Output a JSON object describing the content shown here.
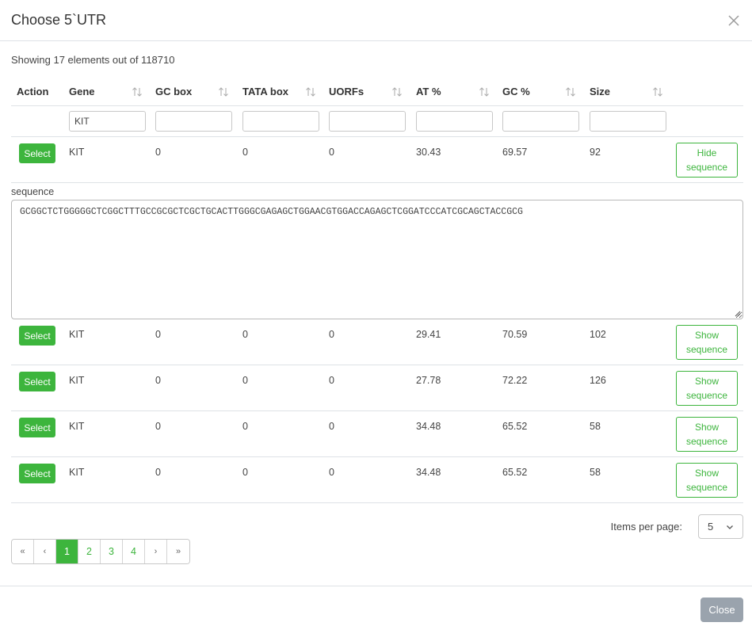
{
  "modal": {
    "title": "Choose 5`UTR",
    "close_label": "Close"
  },
  "summary": "Showing 17 elements out of 118710",
  "columns": [
    {
      "key": "action",
      "label": "Action"
    },
    {
      "key": "gene",
      "label": "Gene"
    },
    {
      "key": "gc_box",
      "label": "GC box"
    },
    {
      "key": "tata_box",
      "label": "TATA box"
    },
    {
      "key": "uorfs",
      "label": "UORFs"
    },
    {
      "key": "at",
      "label": "AT %"
    },
    {
      "key": "gc",
      "label": "GC %"
    },
    {
      "key": "size",
      "label": "Size"
    }
  ],
  "filters": {
    "gene": "KIT",
    "gc_box": "",
    "tata_box": "",
    "uorfs": "",
    "at": "",
    "gc": "",
    "size": ""
  },
  "select_label": "Select",
  "rows": [
    {
      "gene": "KIT",
      "gc_box": "0",
      "tata_box": "0",
      "uorfs": "0",
      "at": "30.43",
      "gc": "69.57",
      "size": "92",
      "toggle_label": "Hide sequence"
    },
    {
      "gene": "KIT",
      "gc_box": "0",
      "tata_box": "0",
      "uorfs": "0",
      "at": "29.41",
      "gc": "70.59",
      "size": "102",
      "toggle_label": "Show sequence"
    },
    {
      "gene": "KIT",
      "gc_box": "0",
      "tata_box": "0",
      "uorfs": "0",
      "at": "27.78",
      "gc": "72.22",
      "size": "126",
      "toggle_label": "Show sequence"
    },
    {
      "gene": "KIT",
      "gc_box": "0",
      "tata_box": "0",
      "uorfs": "0",
      "at": "34.48",
      "gc": "65.52",
      "size": "58",
      "toggle_label": "Show sequence"
    },
    {
      "gene": "KIT",
      "gc_box": "0",
      "tata_box": "0",
      "uorfs": "0",
      "at": "34.48",
      "gc": "65.52",
      "size": "58",
      "toggle_label": "Show sequence"
    }
  ],
  "sequence": {
    "label": "sequence",
    "value": "GCGGCTCTGGGGGCTCGGCTTTGCCGCGCTCGCTGCACTTGGGCGAGAGCTGGAACGTGGACCAGAGCTCGGATCCCATCGCAGCTACCGCG"
  },
  "pagination": {
    "first": "«",
    "prev": "‹",
    "pages": [
      "1",
      "2",
      "3",
      "4"
    ],
    "active": "1",
    "next": "›",
    "last": "»"
  },
  "items_per_page": {
    "label": "Items per page:",
    "value": "5"
  },
  "colors": {
    "accent": "#3db53d",
    "close_button": "#9aa3ad"
  }
}
